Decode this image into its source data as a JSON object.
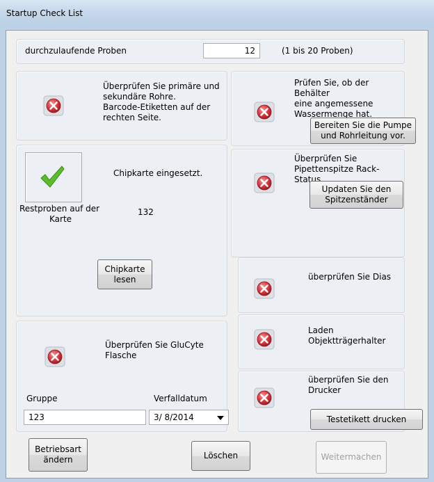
{
  "window": {
    "title": "Startup Check List"
  },
  "samples": {
    "label": "durchzulaufende Proben",
    "value": "12",
    "range": "(1 bis 20 Proben)"
  },
  "tubes": {
    "text": "Überprüfen Sie primäre und sekundäre Rohre. Barcode-Etiketten auf der rechten Seite.",
    "lines": [
      "Überprüfen Sie primäre und",
      "sekundäre Rohre.",
      "Barcode-Etiketten auf der",
      "rechten Seite."
    ],
    "status": "fail"
  },
  "water": {
    "lines": [
      "Prüfen Sie, ob der Behälter",
      "eine angemessene",
      "Wassermenge hat."
    ],
    "button_lines": [
      "Bereiten Sie die Pumpe",
      "und Rohrleitung vor."
    ],
    "status": "fail"
  },
  "chipcard": {
    "inserted": "Chipkarte eingesetzt.",
    "remaining_label_1": "Restproben auf der",
    "remaining_label_2": "Karte",
    "remaining_value": "132",
    "read_button_1": "Chipkarte",
    "read_button_2": "lesen",
    "status": "ok"
  },
  "pipette": {
    "line1": "Überprüfen Sie",
    "line2": "Pipettenspitze Rack-Status",
    "button_1": "Updaten Sie den",
    "button_2": "Spitzenständer",
    "status": "fail"
  },
  "slides": {
    "label": "überprüfen Sie Dias",
    "status": "fail"
  },
  "holder": {
    "label": "Laden Objektträgerhalter",
    "status": "fail"
  },
  "glucyte": {
    "line1": "Überprüfen Sie GluCyte",
    "line2": "Flasche",
    "group_label": "Gruppe",
    "group_value": "123",
    "expiry_label": "Verfalldatum",
    "expiry_value": "3/ 8/2014",
    "status": "fail"
  },
  "printer": {
    "line1": "überprüfen Sie den",
    "line2": "Drucker",
    "button": "Testetikett drucken",
    "status": "fail"
  },
  "footer": {
    "mode_1": "Betriebsart",
    "mode_2": "ändern",
    "clear": "Löschen",
    "continue": "Weitermachen"
  },
  "icons": {
    "fail": "red-x-circle-icon",
    "ok": "green-checkmark-icon",
    "dropdown": "dropdown-arrow-icon"
  },
  "colors": {
    "fail_red": "#d9363e",
    "ok_green": "#5bbd2c",
    "disabled_text": "#a0a0a0"
  }
}
